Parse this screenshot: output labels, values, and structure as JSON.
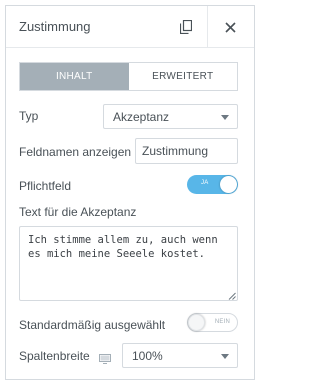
{
  "header": {
    "title": "Zustimmung"
  },
  "tabs": [
    {
      "label": "INHALT",
      "active": true
    },
    {
      "label": "ERWEITERT",
      "active": false
    }
  ],
  "fields": {
    "typ": {
      "label": "Typ",
      "value": "Akzeptanz"
    },
    "feldnamen": {
      "label": "Feldnamen anzeigen",
      "value": "Zustimmung"
    },
    "pflichtfeld": {
      "label": "Pflichtfeld",
      "toggle_text": "JA",
      "on": true
    },
    "akzeptanz_text": {
      "label": "Text für die Akzeptanz",
      "value": "Ich stimme allem zu, auch wenn es mich meine Seeele kostet."
    },
    "standard": {
      "label": "Standardmäßig ausgewählt",
      "toggle_text": "NEIN",
      "on": false
    },
    "spaltenbreite": {
      "label": "Spaltenbreite",
      "value": "100%"
    }
  },
  "icons": {
    "copy": "copy-icon",
    "close": "close-icon",
    "monitor": "monitor-icon"
  },
  "colors": {
    "tab_active_bg": "#a4afb7",
    "toggle_on": "#58b6e8",
    "border": "#d5dadf",
    "text": "#495157"
  }
}
